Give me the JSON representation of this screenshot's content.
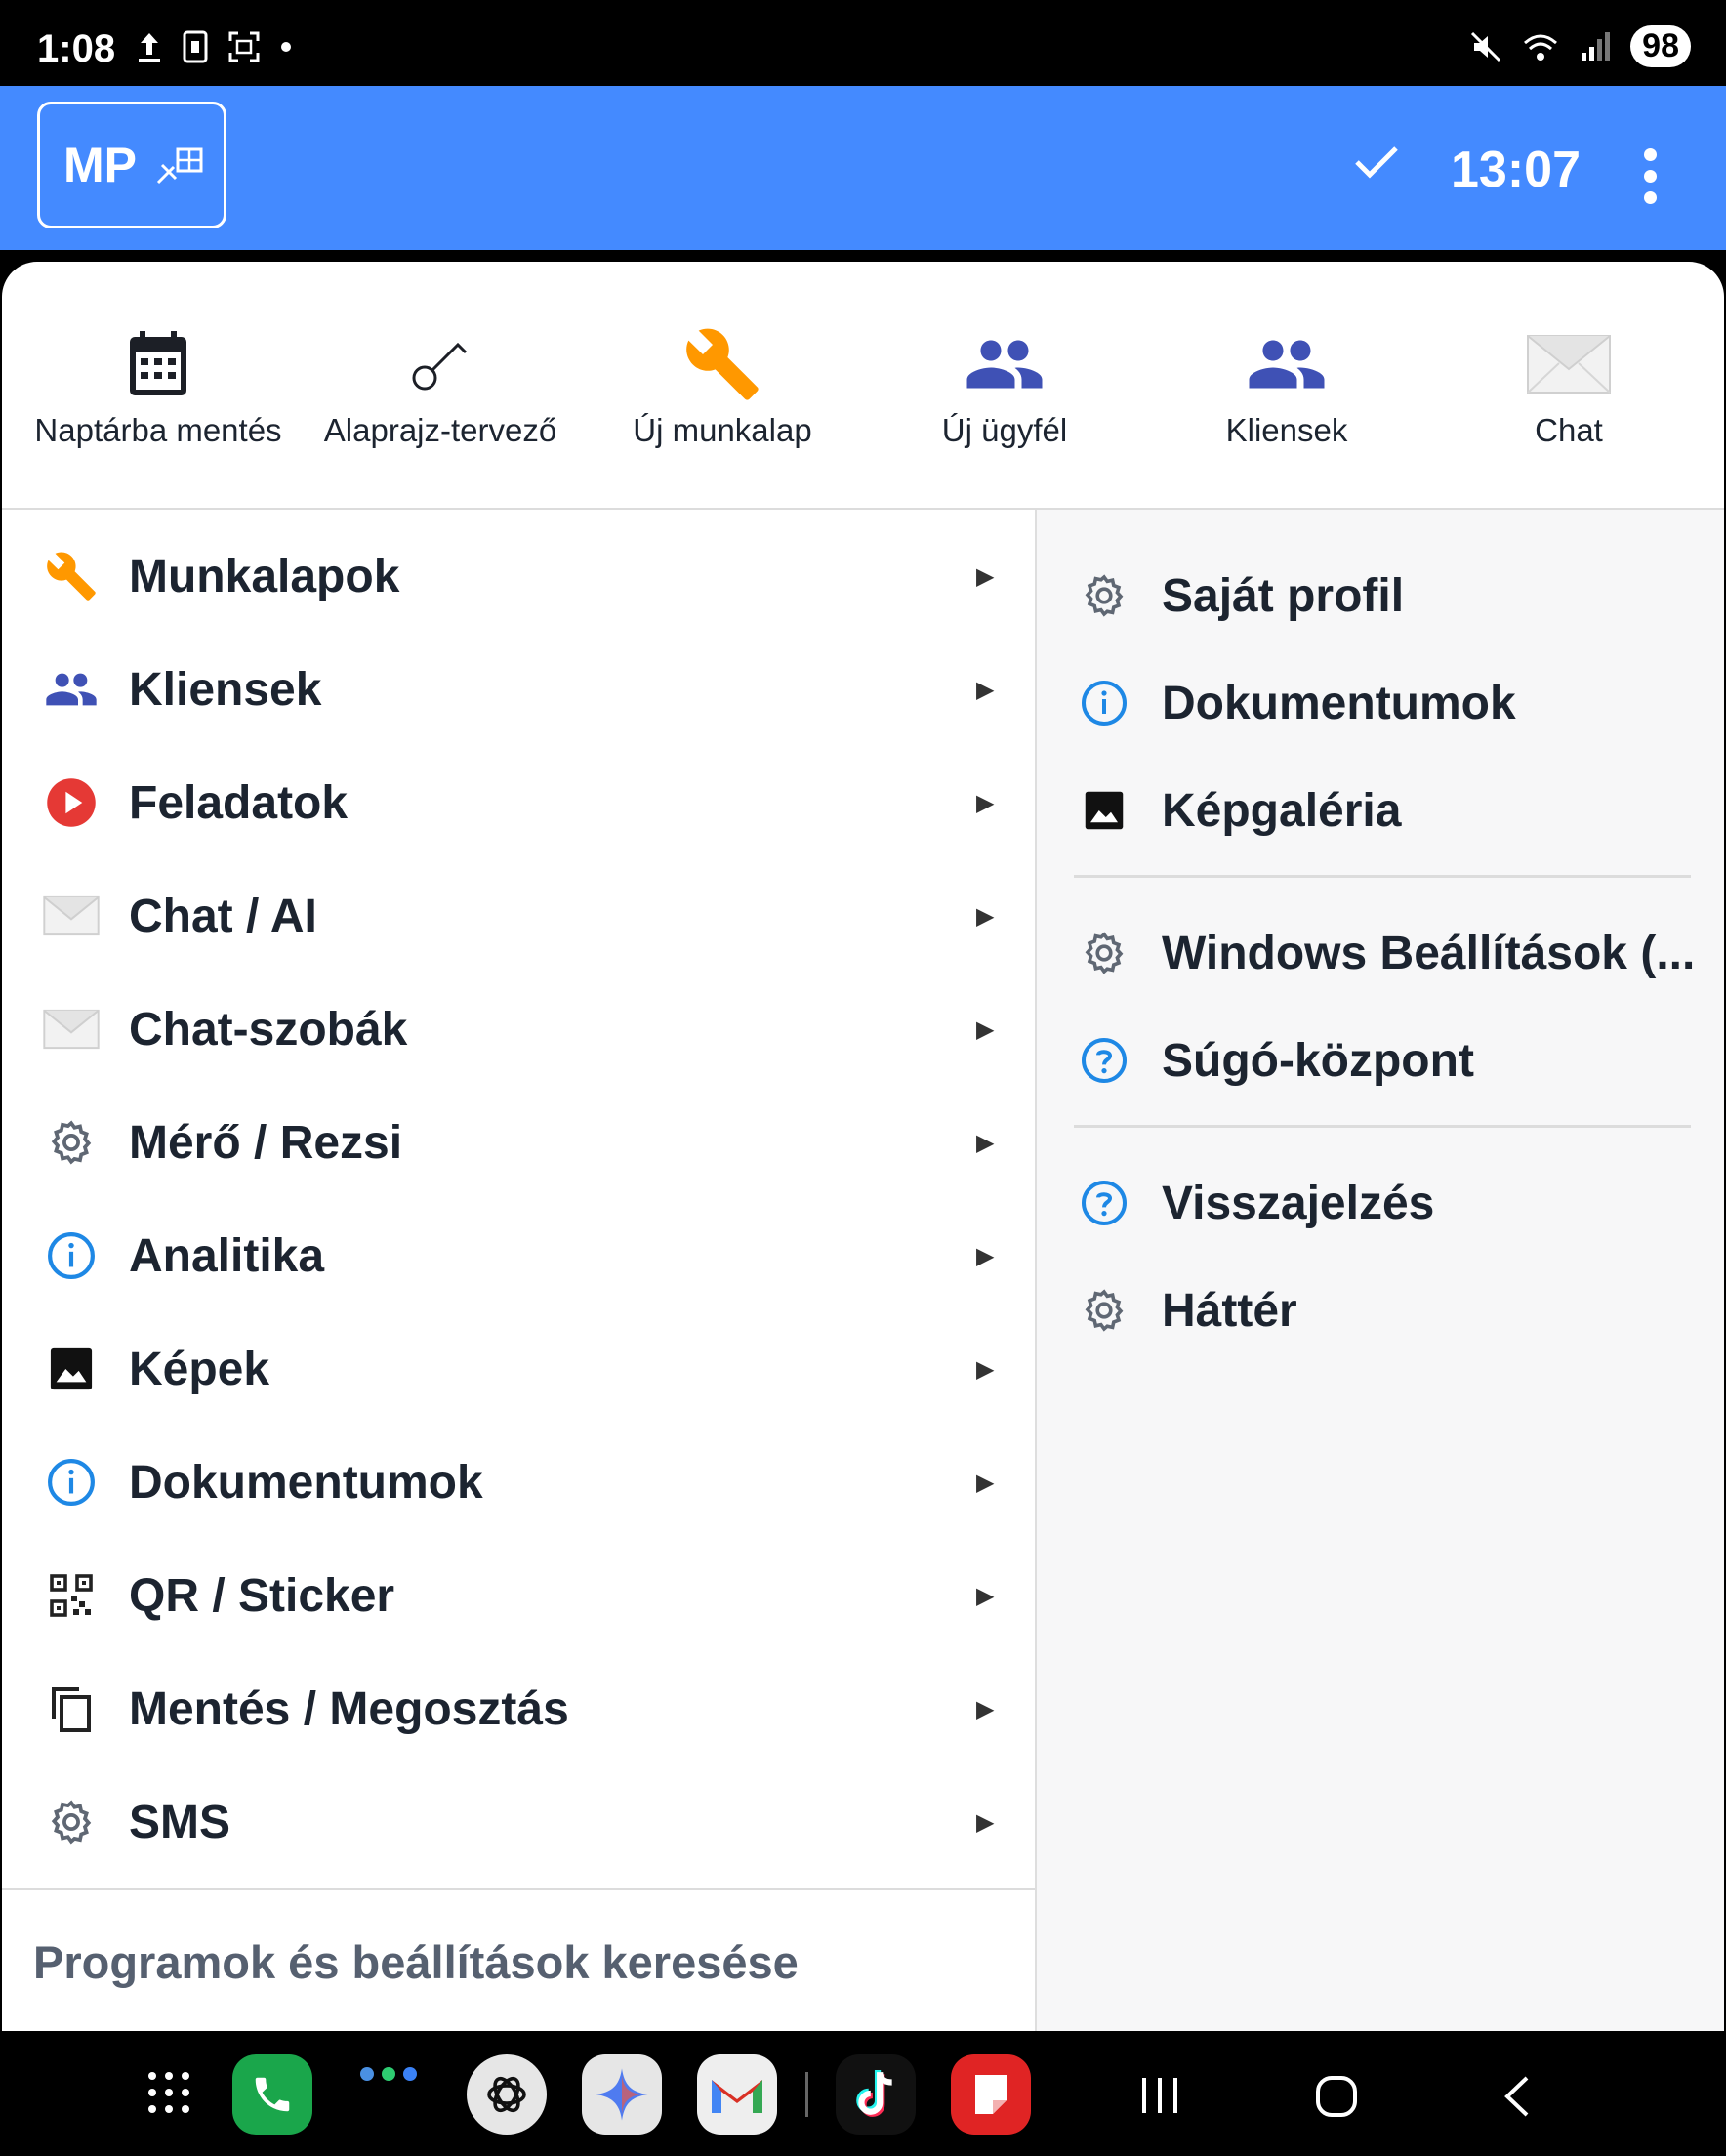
{
  "status_bar": {
    "time": "1:08",
    "battery": "98"
  },
  "app_bar": {
    "badge": "MP",
    "clock": "13:07"
  },
  "quick_actions": [
    {
      "label": "Naptárba mentés",
      "icon": "calendar-icon"
    },
    {
      "label": "Alaprajz-tervező",
      "icon": "key-icon"
    },
    {
      "label": "Új munkalap",
      "icon": "wrench-icon"
    },
    {
      "label": "Új ügyfél",
      "icon": "people-icon"
    },
    {
      "label": "Kliensek",
      "icon": "people-icon"
    },
    {
      "label": "Chat",
      "icon": "envelope-icon"
    }
  ],
  "menu": [
    {
      "label": "Munkalapok",
      "icon": "wrench-icon"
    },
    {
      "label": "Kliensek",
      "icon": "people-icon"
    },
    {
      "label": "Feladatok",
      "icon": "play-icon"
    },
    {
      "label": "Chat / AI",
      "icon": "envelope-icon"
    },
    {
      "label": "Chat-szobák",
      "icon": "envelope-icon"
    },
    {
      "label": "Mérő / Rezsi",
      "icon": "gear-icon"
    },
    {
      "label": "Analitika",
      "icon": "info-icon"
    },
    {
      "label": "Képek",
      "icon": "image-icon"
    },
    {
      "label": "Dokumentumok",
      "icon": "info-icon"
    },
    {
      "label": "QR / Sticker",
      "icon": "qr-icon"
    },
    {
      "label": "Mentés / Megosztás",
      "icon": "copy-icon"
    },
    {
      "label": "SMS",
      "icon": "gear-icon"
    }
  ],
  "menu_arrow": "▶",
  "search_label": "Programok és beállítások keresése",
  "right_menu": [
    {
      "label": "Saját profil",
      "icon": "gear-icon"
    },
    {
      "label": "Dokumentumok",
      "icon": "info-icon"
    },
    {
      "label": "Képgaléria",
      "icon": "image-icon"
    },
    {
      "label": "Windows Beállítások (...",
      "icon": "gear-icon"
    },
    {
      "label": "Súgó-központ",
      "icon": "help-icon"
    },
    {
      "label": "Visszajelzés",
      "icon": "help-icon"
    },
    {
      "label": "Háttér",
      "icon": "gear-icon"
    }
  ],
  "colors": {
    "app_bar": "#448aff",
    "wrench": "#ff9800",
    "people": "#3f51b5",
    "info": "#1e88e5",
    "play": "#e53935"
  }
}
